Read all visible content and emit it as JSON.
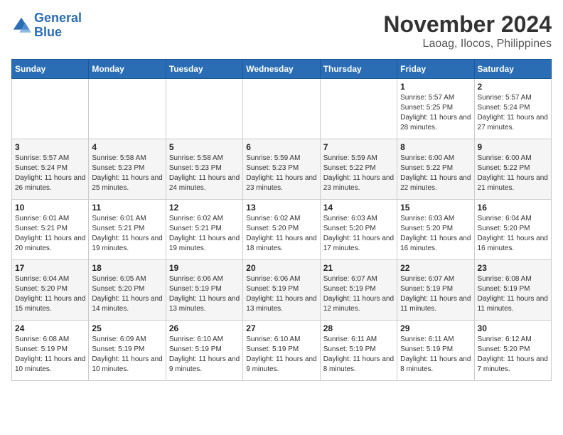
{
  "header": {
    "logo_line1": "General",
    "logo_line2": "Blue",
    "title": "November 2024",
    "subtitle": "Laoag, Ilocos, Philippines"
  },
  "weekdays": [
    "Sunday",
    "Monday",
    "Tuesday",
    "Wednesday",
    "Thursday",
    "Friday",
    "Saturday"
  ],
  "weeks": [
    [
      {
        "day": "",
        "info": ""
      },
      {
        "day": "",
        "info": ""
      },
      {
        "day": "",
        "info": ""
      },
      {
        "day": "",
        "info": ""
      },
      {
        "day": "",
        "info": ""
      },
      {
        "day": "1",
        "info": "Sunrise: 5:57 AM\nSunset: 5:25 PM\nDaylight: 11 hours and 28 minutes."
      },
      {
        "day": "2",
        "info": "Sunrise: 5:57 AM\nSunset: 5:24 PM\nDaylight: 11 hours and 27 minutes."
      }
    ],
    [
      {
        "day": "3",
        "info": "Sunrise: 5:57 AM\nSunset: 5:24 PM\nDaylight: 11 hours and 26 minutes."
      },
      {
        "day": "4",
        "info": "Sunrise: 5:58 AM\nSunset: 5:23 PM\nDaylight: 11 hours and 25 minutes."
      },
      {
        "day": "5",
        "info": "Sunrise: 5:58 AM\nSunset: 5:23 PM\nDaylight: 11 hours and 24 minutes."
      },
      {
        "day": "6",
        "info": "Sunrise: 5:59 AM\nSunset: 5:23 PM\nDaylight: 11 hours and 23 minutes."
      },
      {
        "day": "7",
        "info": "Sunrise: 5:59 AM\nSunset: 5:22 PM\nDaylight: 11 hours and 23 minutes."
      },
      {
        "day": "8",
        "info": "Sunrise: 6:00 AM\nSunset: 5:22 PM\nDaylight: 11 hours and 22 minutes."
      },
      {
        "day": "9",
        "info": "Sunrise: 6:00 AM\nSunset: 5:22 PM\nDaylight: 11 hours and 21 minutes."
      }
    ],
    [
      {
        "day": "10",
        "info": "Sunrise: 6:01 AM\nSunset: 5:21 PM\nDaylight: 11 hours and 20 minutes."
      },
      {
        "day": "11",
        "info": "Sunrise: 6:01 AM\nSunset: 5:21 PM\nDaylight: 11 hours and 19 minutes."
      },
      {
        "day": "12",
        "info": "Sunrise: 6:02 AM\nSunset: 5:21 PM\nDaylight: 11 hours and 19 minutes."
      },
      {
        "day": "13",
        "info": "Sunrise: 6:02 AM\nSunset: 5:20 PM\nDaylight: 11 hours and 18 minutes."
      },
      {
        "day": "14",
        "info": "Sunrise: 6:03 AM\nSunset: 5:20 PM\nDaylight: 11 hours and 17 minutes."
      },
      {
        "day": "15",
        "info": "Sunrise: 6:03 AM\nSunset: 5:20 PM\nDaylight: 11 hours and 16 minutes."
      },
      {
        "day": "16",
        "info": "Sunrise: 6:04 AM\nSunset: 5:20 PM\nDaylight: 11 hours and 16 minutes."
      }
    ],
    [
      {
        "day": "17",
        "info": "Sunrise: 6:04 AM\nSunset: 5:20 PM\nDaylight: 11 hours and 15 minutes."
      },
      {
        "day": "18",
        "info": "Sunrise: 6:05 AM\nSunset: 5:20 PM\nDaylight: 11 hours and 14 minutes."
      },
      {
        "day": "19",
        "info": "Sunrise: 6:06 AM\nSunset: 5:19 PM\nDaylight: 11 hours and 13 minutes."
      },
      {
        "day": "20",
        "info": "Sunrise: 6:06 AM\nSunset: 5:19 PM\nDaylight: 11 hours and 13 minutes."
      },
      {
        "day": "21",
        "info": "Sunrise: 6:07 AM\nSunset: 5:19 PM\nDaylight: 11 hours and 12 minutes."
      },
      {
        "day": "22",
        "info": "Sunrise: 6:07 AM\nSunset: 5:19 PM\nDaylight: 11 hours and 11 minutes."
      },
      {
        "day": "23",
        "info": "Sunrise: 6:08 AM\nSunset: 5:19 PM\nDaylight: 11 hours and 11 minutes."
      }
    ],
    [
      {
        "day": "24",
        "info": "Sunrise: 6:08 AM\nSunset: 5:19 PM\nDaylight: 11 hours and 10 minutes."
      },
      {
        "day": "25",
        "info": "Sunrise: 6:09 AM\nSunset: 5:19 PM\nDaylight: 11 hours and 10 minutes."
      },
      {
        "day": "26",
        "info": "Sunrise: 6:10 AM\nSunset: 5:19 PM\nDaylight: 11 hours and 9 minutes."
      },
      {
        "day": "27",
        "info": "Sunrise: 6:10 AM\nSunset: 5:19 PM\nDaylight: 11 hours and 9 minutes."
      },
      {
        "day": "28",
        "info": "Sunrise: 6:11 AM\nSunset: 5:19 PM\nDaylight: 11 hours and 8 minutes."
      },
      {
        "day": "29",
        "info": "Sunrise: 6:11 AM\nSunset: 5:19 PM\nDaylight: 11 hours and 8 minutes."
      },
      {
        "day": "30",
        "info": "Sunrise: 6:12 AM\nSunset: 5:20 PM\nDaylight: 11 hours and 7 minutes."
      }
    ]
  ]
}
